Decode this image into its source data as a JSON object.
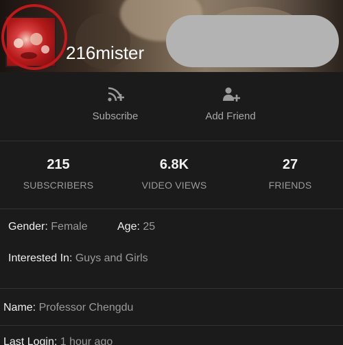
{
  "profile": {
    "username": "216mister"
  },
  "actions": {
    "subscribe": {
      "label": "Subscribe",
      "icon": "rss-plus-icon"
    },
    "add_friend": {
      "label": "Add Friend",
      "icon": "person-plus-icon"
    }
  },
  "stats": [
    {
      "value": "215",
      "label": "SUBSCRIBERS"
    },
    {
      "value": "6.8K",
      "label": "VIDEO VIEWS"
    },
    {
      "value": "27",
      "label": "FRIENDS"
    }
  ],
  "details": {
    "gender": {
      "key": "Gender:",
      "value": "Female"
    },
    "age": {
      "key": "Age:",
      "value": "25"
    },
    "interested_in": {
      "key": "Interested In:",
      "value": "Guys and Girls"
    },
    "name": {
      "key": "Name:",
      "value": "Professor Chengdu"
    },
    "last_login": {
      "key": "Last Login:",
      "value": "1 hour ago"
    }
  },
  "colors": {
    "background": "#1b1b1b",
    "avatar_highlight_ring": "#c4171b",
    "redaction": "#b3b3b3"
  }
}
